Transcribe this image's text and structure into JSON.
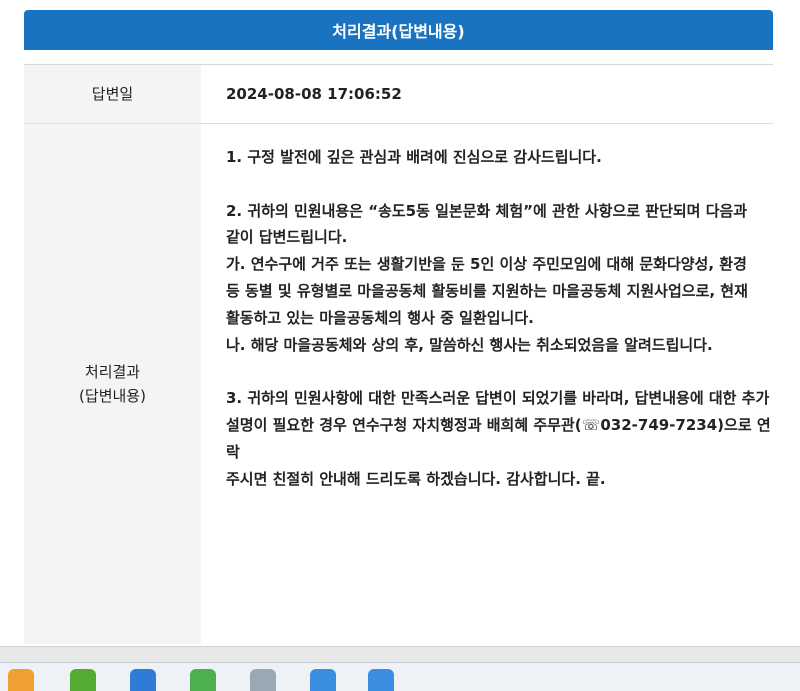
{
  "panel": {
    "title": "처리결과(답변내용)"
  },
  "rows": {
    "date": {
      "label": "답변일",
      "value": "2024-08-08 17:06:52"
    },
    "result": {
      "label_line1": "처리결과",
      "label_line2": "(답변내용)",
      "paragraphs": [
        "1. 구정 발전에 깊은 관심과 배려에 진심으로 감사드립니다.",
        "",
        "2. 귀하의 민원내용은 “송도5동 일본문화 체험”에 관한 사항으로 판단되며 다음과",
        "같이 답변드립니다.",
        "가. 연수구에 거주 또는 생활기반을 둔 5인 이상 주민모임에 대해 문화다양성, 환경",
        "등 동별 및 유형별로 마을공동체 활동비를 지원하는 마을공동체 지원사업으로, 현재",
        "활동하고 있는 마을공동체의 행사 중 일환입니다.",
        "나. 해당 마을공동체와 상의 후, 말씀하신 행사는 취소되었음을 알려드립니다.",
        "",
        "3. 귀하의 민원사항에 대한 만족스러운 답변이 되었기를 바라며, 답변내용에 대한 추가",
        "설명이 필요한 경우 연수구청 자치행정과 배희혜 주무관(☏032-749-7234)으로 연락",
        "주시면 친절히 안내해 드리도록 하겠습니다. 감사합니다. 끝."
      ]
    }
  },
  "taskbar": {
    "icons": [
      "mail-icon",
      "music-icon",
      "app-icon",
      "chat-icon",
      "rocket-icon",
      "app-blue-icon",
      "app-blue-icon-2"
    ],
    "colors": [
      "#f0a030",
      "#55aa33",
      "#2e7cd6",
      "#4caf50",
      "#9aa7b5",
      "#3b8ee0",
      "#3b8ee0"
    ]
  }
}
